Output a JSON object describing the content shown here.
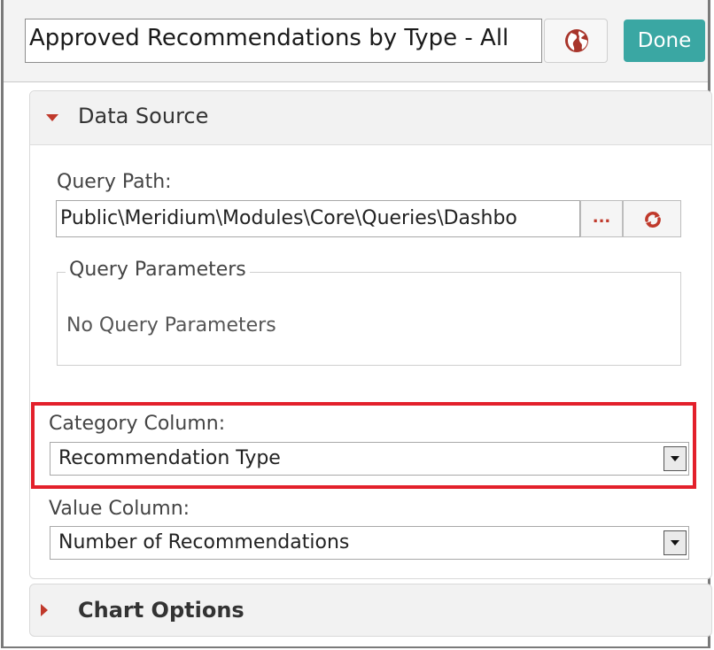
{
  "header": {
    "title_value": "Approved Recommendations by Type - All",
    "globe_icon": "globe-icon",
    "done_label": "Done"
  },
  "data_source": {
    "section_title": "Data Source",
    "query_path_label": "Query Path:",
    "query_path_value": "Public\\Meridium\\Modules\\Core\\Queries\\Dashbo",
    "browse_label": "...",
    "refresh_icon": "refresh-icon",
    "query_parameters_legend": "Query Parameters",
    "no_query_parameters": "No Query Parameters",
    "category_column_label": "Category Column:",
    "category_column_value": "Recommendation Type",
    "value_column_label": "Value Column:",
    "value_column_value": "Number of Recommendations"
  },
  "chart_options": {
    "section_title": "Chart Options"
  },
  "colors": {
    "accent_done": "#3aa7a3",
    "caret": "#c0392b",
    "highlight_border": "#e3202b"
  }
}
